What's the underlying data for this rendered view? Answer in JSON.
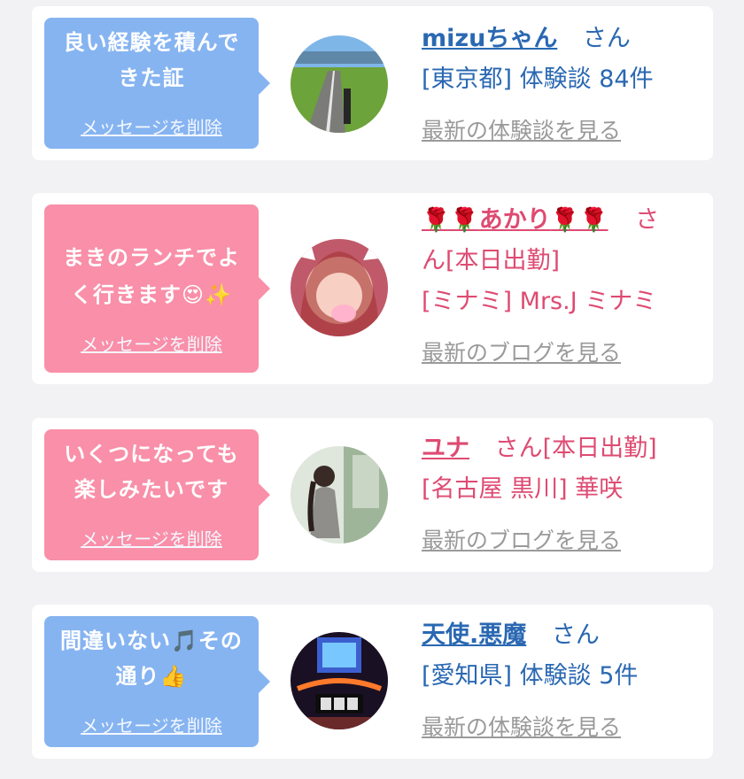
{
  "messages": [
    {
      "bubble_line1": "良い経験を積んで",
      "bubble_line2": "きた証",
      "delete_label": "メッセージを削除",
      "name": "mizuちゃん",
      "honorific": "さん",
      "line2": "[東京都] 体験談 84件",
      "link_label": "最新の体験談を見る"
    },
    {
      "bubble_line1": "まきのランチでよ",
      "bubble_line2": "く行きます😍✨",
      "delete_label": "メッセージを削除",
      "name_prefix": "🌹🌹",
      "name": "あかり",
      "name_suffix": "🌹🌹",
      "honorific": "さ",
      "line2": "ん[本日出勤]",
      "line3": "[ミナミ] Mrs.J ミナミ",
      "link_label": "最新のブログを見る"
    },
    {
      "bubble_line1": "いくつになっても",
      "bubble_line2": "楽しみたいです",
      "delete_label": "メッセージを削除",
      "name": "ユナ",
      "honorific": "さん[本日出勤]",
      "line2": "[名古屋 黒川] 華咲",
      "link_label": "最新のブログを見る"
    },
    {
      "bubble_line1": "間違いない🎵その",
      "bubble_line2": "通り👍",
      "delete_label": "メッセージを削除",
      "name": "天使.悪魔",
      "honorific": "さん",
      "line2": "[愛知県] 体験談 5件",
      "link_label": "最新の体験談を見る"
    }
  ],
  "colors": {
    "bubble_blue": "#86b4f1",
    "bubble_pink": "#f98fa8",
    "text_blue": "#2a68b2",
    "text_pink": "#de4b72",
    "link_gray": "#9a9a9a",
    "background": "#f2f2f4"
  }
}
